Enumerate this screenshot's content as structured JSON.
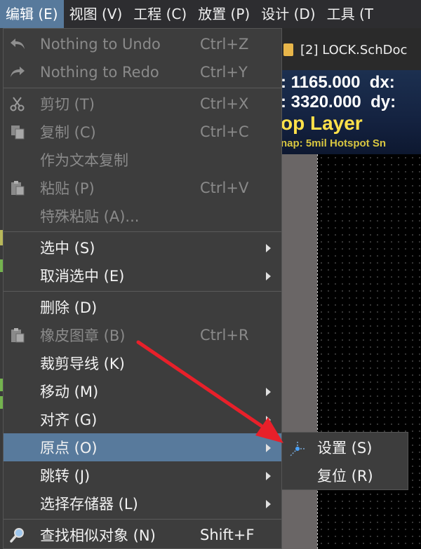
{
  "menubar": {
    "items": [
      "编辑 (E)",
      "视图 (V)",
      "工程 (C)",
      "放置 (P)",
      "设计 (D)",
      "工具 (T"
    ]
  },
  "document_tab": {
    "label": "[2] LOCK.SchDoc"
  },
  "hud": {
    "x_value": ": 1165.000",
    "x_delta_label": "dx:",
    "y_value": ": 3320.000",
    "y_delta_label": "dy:",
    "layer": "op Layer",
    "snap": "nap: 5mil Hotspot Sn"
  },
  "edit_menu": {
    "items": [
      {
        "label": "Nothing to Undo",
        "shortcut": "Ctrl+Z",
        "icon": "undo-icon",
        "disabled": true
      },
      {
        "label": "Nothing to Redo",
        "shortcut": "Ctrl+Y",
        "icon": "redo-icon",
        "disabled": true
      },
      {
        "label": "剪切 (T)",
        "shortcut": "Ctrl+X",
        "icon": "scissors-icon",
        "disabled": true
      },
      {
        "label": "复制 (C)",
        "shortcut": "Ctrl+C",
        "icon": "copy-icon",
        "disabled": true
      },
      {
        "label": "作为文本复制",
        "shortcut": "",
        "icon": "",
        "disabled": true
      },
      {
        "label": "粘贴 (P)",
        "shortcut": "Ctrl+V",
        "icon": "paste-icon",
        "disabled": true
      },
      {
        "label": "特殊粘贴 (A)...",
        "shortcut": "",
        "icon": "",
        "disabled": true
      },
      {
        "label": "选中 (S)",
        "submenu": true
      },
      {
        "label": "取消选中 (E)",
        "submenu": true
      },
      {
        "label": "删除 (D)"
      },
      {
        "label": "橡皮图章 (B)",
        "shortcut": "Ctrl+R",
        "icon": "rubber-stamp-icon",
        "disabled": true
      },
      {
        "label": "裁剪导线 (K)"
      },
      {
        "label": "移动 (M)",
        "submenu": true
      },
      {
        "label": "对齐 (G)",
        "submenu": true
      },
      {
        "label": "原点 (O)",
        "submenu": true,
        "highlighted": true
      },
      {
        "label": "跳转 (J)",
        "submenu": true
      },
      {
        "label": "选择存储器 (L)",
        "submenu": true
      },
      {
        "label": "查找相似对象 (N)",
        "shortcut": "Shift+F",
        "icon": "search-icon"
      }
    ]
  },
  "origin_submenu": {
    "items": [
      {
        "label": "设置 (S)",
        "icon": "origin-icon"
      },
      {
        "label": "复位 (R)"
      }
    ]
  },
  "colors": {
    "highlight": "#587a9c",
    "annotation_arrow": "#e8202a",
    "layer_text": "#ffe14a"
  }
}
